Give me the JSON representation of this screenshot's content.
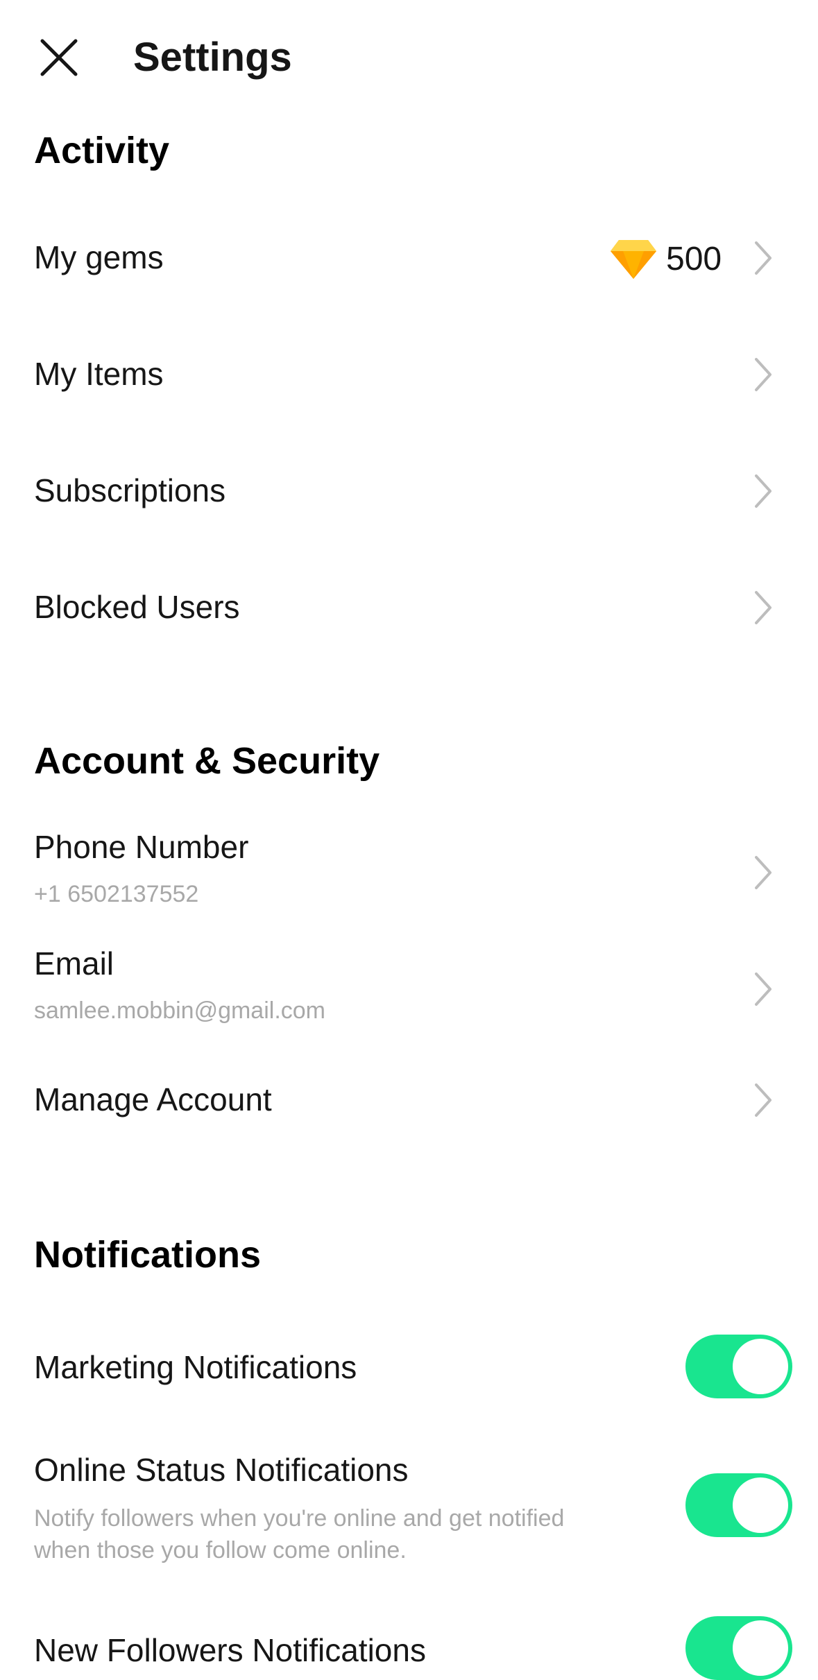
{
  "header": {
    "title": "Settings",
    "close_icon": "close-icon"
  },
  "activity": {
    "title": "Activity",
    "items": [
      {
        "label": "My gems",
        "value": "500",
        "icon": "gem-icon"
      },
      {
        "label": "My Items"
      },
      {
        "label": "Subscriptions"
      },
      {
        "label": "Blocked Users"
      }
    ]
  },
  "account": {
    "title": "Account & Security",
    "items": [
      {
        "label": "Phone Number",
        "sub": "+1 6502137552"
      },
      {
        "label": "Email",
        "sub": "samlee.mobbin@gmail.com"
      },
      {
        "label": "Manage Account"
      }
    ]
  },
  "notifications": {
    "title": "Notifications",
    "items": [
      {
        "label": "Marketing Notifications",
        "enabled": true
      },
      {
        "label": "Online Status Notifications",
        "desc": "Notify followers when you're online and get notified when those you follow come online.",
        "enabled": true
      },
      {
        "label": "New Followers Notifications",
        "enabled": true
      }
    ]
  },
  "colors": {
    "toggle_on": "#19e58f",
    "gem": "#ffb300",
    "secondary_text": "#a8a8a8",
    "chevron": "#bdbdbd"
  }
}
